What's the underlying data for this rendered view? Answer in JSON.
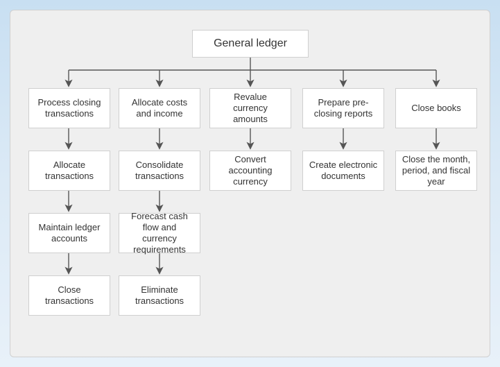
{
  "chart_data": {
    "type": "tree",
    "root": "General ledger",
    "children": [
      {
        "label": "Process closing transactions",
        "children": [
          {
            "label": "Allocate transactions",
            "children": [
              {
                "label": "Maintain ledger accounts",
                "children": [
                  {
                    "label": "Close transactions"
                  }
                ]
              }
            ]
          }
        ]
      },
      {
        "label": "Allocate costs and income",
        "children": [
          {
            "label": "Consolidate transactions",
            "children": [
              {
                "label": "Forecast cash flow and currency requirements",
                "children": [
                  {
                    "label": "Eliminate transactions"
                  }
                ]
              }
            ]
          }
        ]
      },
      {
        "label": "Revalue currency amounts",
        "children": [
          {
            "label": "Convert accounting currency"
          }
        ]
      },
      {
        "label": "Prepare pre-closing reports",
        "children": [
          {
            "label": "Create electronic documents"
          }
        ]
      },
      {
        "label": "Close books",
        "children": [
          {
            "label": "Close the month, period, and fiscal year"
          }
        ]
      }
    ]
  },
  "nodes": {
    "root": "General ledger",
    "c1": "Process closing transactions",
    "c2": "Allocate costs and income",
    "c3": "Revalue currency amounts",
    "c4": "Prepare pre-closing reports",
    "c5": "Close books",
    "c1a": "Allocate transactions",
    "c1b": "Maintain ledger accounts",
    "c1c": "Close transactions",
    "c2a": "Consolidate transactions",
    "c2b": "Forecast cash flow and currency requirements",
    "c2c": "Eliminate transactions",
    "c3a": "Convert accounting currency",
    "c4a": "Create electronic documents",
    "c5a": "Close the month, period, and fiscal year"
  }
}
